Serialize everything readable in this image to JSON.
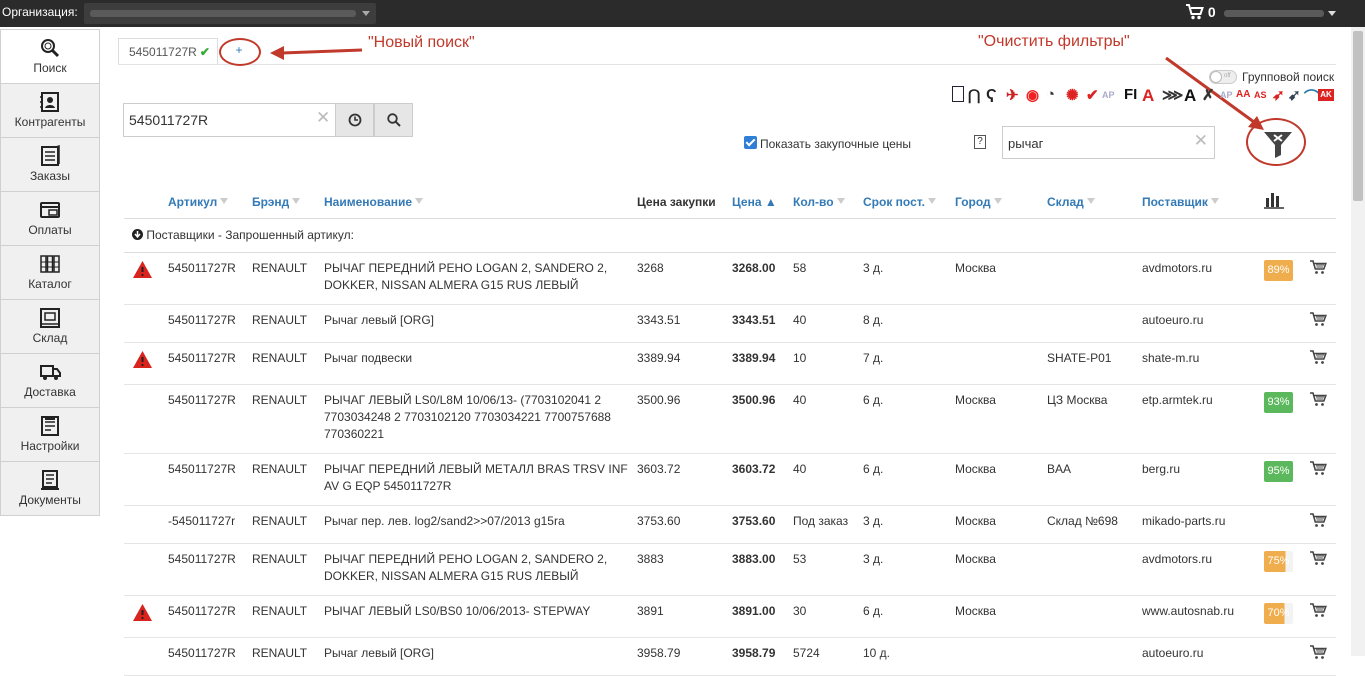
{
  "topbar": {
    "org_label": "Организация:",
    "cart_count": "0"
  },
  "sidebar": {
    "items": [
      {
        "label": "Поиск",
        "icon": "search-doc-icon"
      },
      {
        "label": "Контрагенты",
        "icon": "contacts-icon"
      },
      {
        "label": "Заказы",
        "icon": "orders-icon"
      },
      {
        "label": "Оплаты",
        "icon": "payments-icon"
      },
      {
        "label": "Каталог",
        "icon": "catalog-icon"
      },
      {
        "label": "Склад",
        "icon": "warehouse-icon"
      },
      {
        "label": "Доставка",
        "icon": "delivery-icon"
      },
      {
        "label": "Настройки",
        "icon": "settings-icon"
      },
      {
        "label": "Документы",
        "icon": "documents-icon"
      }
    ]
  },
  "tabs": {
    "active_label": "545011727R",
    "add_label": "+"
  },
  "annotations": {
    "new_search": "\"Новый поиск\"",
    "clear_filters": "\"Очистить фильтры\""
  },
  "search": {
    "value": "545011727R"
  },
  "group_search": {
    "toggle_text": "off",
    "label": "Групповой поиск"
  },
  "show_purchase_prices": {
    "label": "Показать закупочные цены",
    "checked": true
  },
  "help": "?",
  "filter": {
    "value": "рычаг"
  },
  "colors": {
    "accent": "#337ab7",
    "annotation": "#c0392b",
    "badge_orange": "#f0ad4e",
    "badge_green": "#5cb85c",
    "warning": "#d9231d"
  },
  "table": {
    "headers": {
      "article": "Артикул",
      "brand": "Брэнд",
      "name": "Наименование",
      "purchase_price": "Цена закупки",
      "price": "Цена ▲",
      "qty": "Кол-во",
      "delivery": "Срок пост.",
      "city": "Город",
      "warehouse": "Склад",
      "supplier": "Поставщик"
    },
    "group_label": "Поставщики - Запрошенный артикул:",
    "rows": [
      {
        "warn": true,
        "article": "545011727R",
        "brand": "RENAULT",
        "name": "РЫЧАГ ПЕРЕДНИЙ РЕНО LOGAN 2, SANDERO 2, DOKKER, NISSAN ALMERA G15 RUS ЛЕВЫЙ",
        "purchase": "3268",
        "price": "3268.00",
        "qty": "58",
        "days": "3 д.",
        "city": "Москва",
        "warehouse": "",
        "supplier": "avdmotors.ru",
        "badge": "89%",
        "badge_color": "orange",
        "badge_fill": 1.0
      },
      {
        "warn": false,
        "article": "545011727R",
        "brand": "RENAULT",
        "name": "Рычаг левый [ORG]",
        "purchase": "3343.51",
        "price": "3343.51",
        "qty": "40",
        "days": "8 д.",
        "city": "",
        "warehouse": "",
        "supplier": "autoeuro.ru",
        "badge": "",
        "badge_color": "",
        "badge_fill": 0
      },
      {
        "warn": true,
        "article": "545011727R",
        "brand": "RENAULT",
        "name": "Рычаг подвески",
        "purchase": "3389.94",
        "price": "3389.94",
        "qty": "10",
        "days": "7 д.",
        "city": "",
        "warehouse": "SHATE-P01",
        "supplier": "shate-m.ru",
        "badge": "",
        "badge_color": "",
        "badge_fill": 0
      },
      {
        "warn": false,
        "article": "545011727R",
        "brand": "RENAULT",
        "name": "РЫЧАГ ЛЕВЫЙ LS0/L8M 10/06/13- (7703102041 2 7703034248 2 7703102120 7703034221 7700757688 770360221",
        "purchase": "3500.96",
        "price": "3500.96",
        "qty": "40",
        "days": "6 д.",
        "city": "Москва",
        "warehouse": "ЦЗ Москва",
        "supplier": "etp.armtek.ru",
        "badge": "93%",
        "badge_color": "green",
        "badge_fill": 1.0
      },
      {
        "warn": false,
        "article": "545011727R",
        "brand": "RENAULT",
        "name": "РЫЧАГ ПЕРЕДНИЙ ЛЕВЫЙ МЕТАЛЛ BRAS TRSV INF AV G EQP 545011727R",
        "purchase": "3603.72",
        "price": "3603.72",
        "qty": "40",
        "days": "6 д.",
        "city": "Москва",
        "warehouse": "BAA",
        "supplier": "berg.ru",
        "badge": "95%",
        "badge_color": "green",
        "badge_fill": 1.0
      },
      {
        "warn": false,
        "article": "-545011727r",
        "brand": "RENAULT",
        "name": "Рычаг пер. лев. log2/sand2>>07/2013 g15ra",
        "purchase": "3753.60",
        "price": "3753.60",
        "qty": "Под заказ",
        "days": "3 д.",
        "city": "Москва",
        "warehouse": "Склад №698",
        "supplier": "mikado-parts.ru",
        "badge": "",
        "badge_color": "",
        "badge_fill": 0
      },
      {
        "warn": false,
        "article": "545011727R",
        "brand": "RENAULT",
        "name": "РЫЧАГ ПЕРЕДНИЙ РЕНО LOGAN 2, SANDERO 2, DOKKER, NISSAN ALMERA G15 RUS ЛЕВЫЙ",
        "purchase": "3883",
        "price": "3883.00",
        "qty": "53",
        "days": "3 д.",
        "city": "Москва",
        "warehouse": "",
        "supplier": "avdmotors.ru",
        "badge": "75%",
        "badge_color": "orange",
        "badge_fill": 0.75
      },
      {
        "warn": true,
        "article": "545011727R",
        "brand": "RENAULT",
        "name": "РЫЧАГ ЛЕВЫЙ LS0/BS0 10/06/2013- STEPWAY",
        "purchase": "3891",
        "price": "3891.00",
        "qty": "30",
        "days": "6 д.",
        "city": "Москва",
        "warehouse": "",
        "supplier": "www.autosnab.ru",
        "badge": "70%",
        "badge_color": "orange",
        "badge_fill": 0.7
      },
      {
        "warn": false,
        "article": "545011727R",
        "brand": "RENAULT",
        "name": "Рычаг левый [ORG]",
        "purchase": "3958.79",
        "price": "3958.79",
        "qty": "5724",
        "days": "10 д.",
        "city": "",
        "warehouse": "",
        "supplier": "autoeuro.ru",
        "badge": "",
        "badge_color": "",
        "badge_fill": 0
      }
    ]
  }
}
